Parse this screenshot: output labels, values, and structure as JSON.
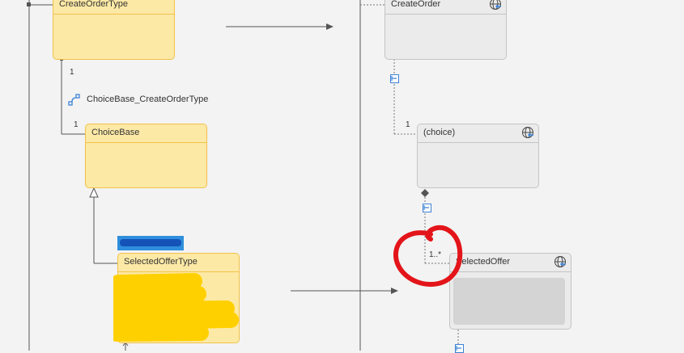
{
  "left": {
    "create_order_type": {
      "title": "CreateOrderType"
    },
    "multiplicity_top": "1",
    "association_label": "ChoiceBase_CreateOrderType",
    "multiplicity_bottom": "1",
    "choice_base": {
      "title": "ChoiceBase"
    },
    "selected_offer_type": {
      "title": "SelectedOfferType"
    }
  },
  "right": {
    "create_order": {
      "title": "CreateOrder"
    },
    "multiplicity_choice": "1",
    "choice": {
      "title": "(choice)"
    },
    "multiplicity_selected": "1..*",
    "selected_offer": {
      "title": "SelectedOffer"
    }
  },
  "colors": {
    "type_fill": "#fde9a6",
    "type_border": "#f0c24a",
    "element_fill": "#ebebeb",
    "element_border": "#c4c4c4",
    "annotation_red": "#e3151a",
    "redaction_yellow": "#ffd000",
    "redaction_blue": "#1565c0",
    "pin_blue": "#3b82d6"
  },
  "icons": [
    "globe-icon",
    "association-icon",
    "expand-pin-icon",
    "diamond-icon",
    "inheritance-arrow-icon"
  ]
}
